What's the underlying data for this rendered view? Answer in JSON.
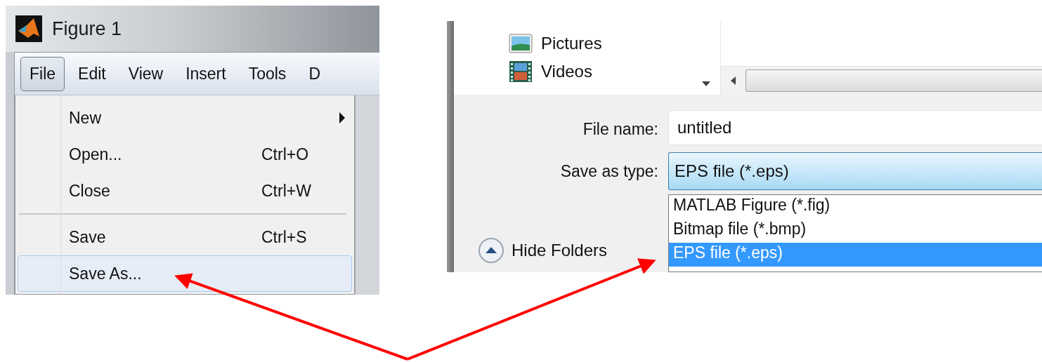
{
  "figure_window": {
    "title": "Figure 1",
    "menu_bar": [
      {
        "label": "File",
        "selected": true
      },
      {
        "label": "Edit",
        "selected": false
      },
      {
        "label": "View",
        "selected": false
      },
      {
        "label": "Insert",
        "selected": false
      },
      {
        "label": "Tools",
        "selected": false
      },
      {
        "label": "D",
        "selected": false
      }
    ],
    "file_menu": [
      {
        "kind": "submenu",
        "label": "New",
        "selected": false
      },
      {
        "kind": "item",
        "label": "Open...",
        "shortcut": "Ctrl+O",
        "selected": false
      },
      {
        "kind": "item",
        "label": "Close",
        "shortcut": "Ctrl+W",
        "selected": false
      },
      {
        "kind": "separator"
      },
      {
        "kind": "item",
        "label": "Save",
        "shortcut": "Ctrl+S",
        "selected": false
      },
      {
        "kind": "item",
        "label": "Save As...",
        "selected": true
      }
    ]
  },
  "save_dialog": {
    "nav_items": [
      {
        "kind": "pictures",
        "label": "Pictures"
      },
      {
        "kind": "videos",
        "label": "Videos"
      }
    ],
    "file_name_label": "File name:",
    "file_name": "untitled",
    "type_label": "Save as type:",
    "type_value": "EPS file (*.eps)",
    "type_options": [
      {
        "label": "MATLAB Figure (*.fig)",
        "selected": false
      },
      {
        "label": "Bitmap file (*.bmp)",
        "selected": false
      },
      {
        "label": "EPS file (*.eps)",
        "selected": true
      }
    ],
    "hide_folders": "Hide Folders"
  }
}
